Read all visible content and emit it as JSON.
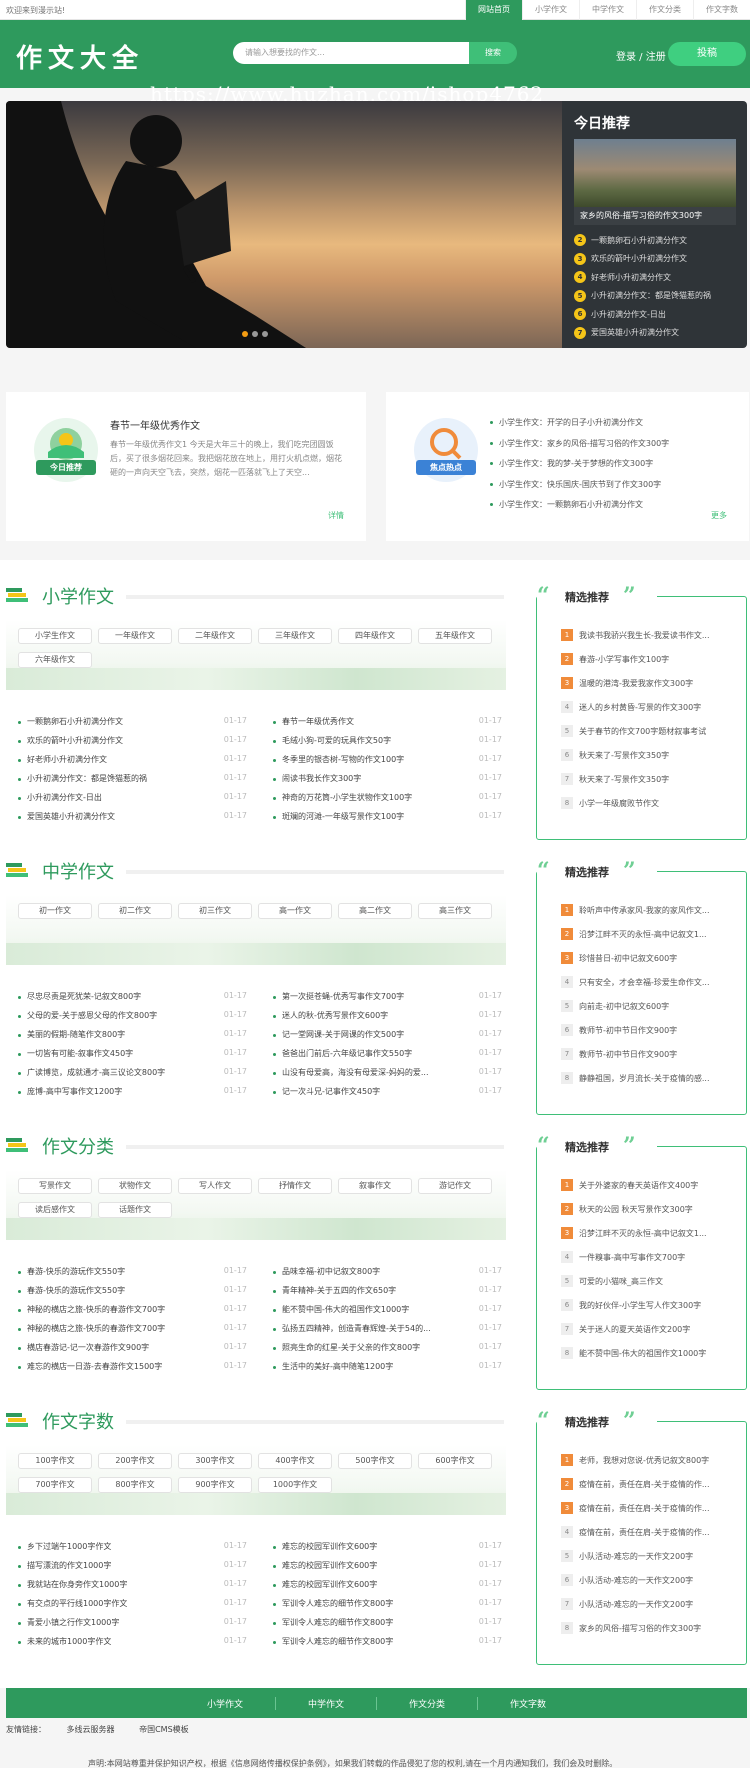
{
  "topbar": {
    "welcome": "欢迎来到漫示站!",
    "nav": [
      "网站首页",
      "小学作文",
      "中学作文",
      "作文分类",
      "作文字数"
    ]
  },
  "header": {
    "logo": "作文大全",
    "search_placeholder": "请输入想要找的作文...",
    "search_button": "搜索",
    "login": "登录 / 注册",
    "submit": "投稿",
    "watermark": "https://www.huzhan.com/ishop4762"
  },
  "colors": {
    "brand": "#2e9a5d",
    "accent": "#3fbf78",
    "hot": "#f08b3a",
    "rank": "#f5c518"
  },
  "today": {
    "title": "今日推荐",
    "caption": "家乡的风俗-描写习俗的作文300字",
    "items": [
      {
        "n": "2",
        "t": "一颗鹅卵石小升初满分作文"
      },
      {
        "n": "3",
        "t": "欢乐的箭叶小升初满分作文"
      },
      {
        "n": "4",
        "t": "好老师小升初满分作文"
      },
      {
        "n": "5",
        "t": "小升初满分作文：都是馋猫惹的祸"
      },
      {
        "n": "6",
        "t": "小升初满分作文-日出"
      },
      {
        "n": "7",
        "t": "爱国英雄小升初满分作文"
      }
    ]
  },
  "card1": {
    "badge": "今日推荐",
    "title": "春节一年级优秀作文",
    "summary": "春节一年级优秀作文1 今天是大年三十的晚上，我们吃完团圆饭后，买了很多烟花回来。我把烟花放在地上，用打火机点燃，烟花砸的一声向天空飞去，突然，烟花一匹落就飞上了天空...",
    "more": "详情"
  },
  "card2": {
    "badge": "焦点热点",
    "items": [
      "小学生作文：开学的日子小升初满分作文",
      "小学生作文：家乡的风俗-描写习俗的作文300字",
      "小学生作文：我的梦-关于梦想的作文300字",
      "小学生作文：快乐国庆-国庆节到了作文300字",
      "小学生作文：一颗鹅卵石小升初满分作文"
    ],
    "more": "更多"
  },
  "sections": [
    {
      "title": "小学作文",
      "grades": [
        "小学生作文",
        "一年级作文",
        "二年级作文",
        "三年级作文",
        "四年级作文",
        "五年级作文",
        "六年级作文"
      ],
      "left": [
        "一颗鹅卵石小升初满分作文",
        "欢乐的箭叶小升初满分作文",
        "好老师小升初满分作文",
        "小升初满分作文：都是馋猫惹的祸",
        "小升初满分作文-日出",
        "爱国英雄小升初满分作文"
      ],
      "right": [
        "春节一年级优秀作文",
        "毛绒小狗-可爱的玩具作文50字",
        "冬季里的银杏树-写物的作文100字",
        "闹读书我长作文300字",
        "神奇的万花筒-小学生状物作文100字",
        "斑斓的河滩-一年级写景作文100字"
      ],
      "date": "01-17",
      "pick_title": "精选推荐",
      "pick": [
        "我读书我骄兴我生长-我爱读书作文...",
        "春游-小学写事作文100字",
        "温暖的港湾-我爱我家作文300字",
        "迷人的乡村黄昏-写景的作文300字",
        "关于春节的作文700字题材叙事考试",
        "秋天来了-写景作文350字",
        "秋天来了-写景作文350字",
        "小学一年级腐败节作文"
      ]
    },
    {
      "title": "中学作文",
      "grades": [
        "初一作文",
        "初二作文",
        "初三作文",
        "高一作文",
        "高二作文",
        "高三作文"
      ],
      "left": [
        "尽忠尽责是死犹荣-记叙文800字",
        "父母的爱-关于感恩父母的作文800字",
        "美丽的假期-随笔作文800字",
        "一切皆有可能-叙事作文450字",
        "广读博览，成就通才-高三议论文800字",
        "庞博-高中写事作文1200字"
      ],
      "right": [
        "第一次挺苍蝇-优秀写事作文700字",
        "迷人的秋-优秀写景作文600字",
        "记一堂网课-关于网课的作文500字",
        "爸爸出门前后-六年级记事作文550字",
        "山没有母爱高，海没有母爱深-妈妈的爱...",
        "记一次斗兄-记事作文450字"
      ],
      "date": "01-17",
      "pick_title": "精选推荐",
      "pick": [
        "聆听声中传承家风-我家的家风作文...",
        "沿梦江畔不灭的永恒-高中记叙文1...",
        "珍惜昔日-初中记叙文600字",
        "只有安全，才会幸福-珍爱生命作文...",
        "向前走-初中记叙文600字",
        "教师节-初中节日作文900字",
        "教师节-初中节日作文900字",
        "静静祖国，岁月流长-关于疫情的感..."
      ]
    },
    {
      "title": "作文分类",
      "grades": [
        "写景作文",
        "状物作文",
        "写人作文",
        "抒情作文",
        "叙事作文",
        "游记作文",
        "读后感作文",
        "话题作文"
      ],
      "left": [
        "春游-快乐的游玩作文550字",
        "春游-快乐的游玩作文550字",
        "神秘的横店之旅-快乐的春游作文700字",
        "神秘的横店之旅-快乐的春游作文700字",
        "横店春游记-记一次春游作文900字",
        "难忘的横店一日游-去春游作文1500字"
      ],
      "right": [
        "品味幸福-初中记叙文800字",
        "青年精神-关于五四的作文650字",
        "能不赞中国-伟大的祖国作文1000字",
        "弘扬五四精神，创造青春辉煌-关于54的...",
        "照亮生命的红星-关于父亲的作文800字",
        "生活中的美好-高中随笔1200字"
      ],
      "date": "01-17",
      "pick_title": "精选推荐",
      "pick": [
        "关于外婆家的春天英语作文400字",
        "秋天的公园 秋天写景作文300字",
        "沿梦江畔不灭的永恒-高中记叙文1...",
        "一件糗事-高中写事作文700字",
        "可爱的小猫咪_高三作文",
        "我的好伙伴-小学生写人作文300字",
        "关于迷人的夏天英语作文200字",
        "能不赞中国-伟大的祖国作文1000字"
      ]
    },
    {
      "title": "作文字数",
      "grades": [
        "100字作文",
        "200字作文",
        "300字作文",
        "400字作文",
        "500字作文",
        "600字作文",
        "700字作文",
        "800字作文",
        "900字作文",
        "1000字作文"
      ],
      "left": [
        "乡下过端午1000字作文",
        "描写漂流的作文1000字",
        "我就站在你身旁作文1000字",
        "有交点的平行线1000字作文",
        "青爱小镇之行作文1000字",
        "未来的城市1000字作文"
      ],
      "right": [
        "难忘的校园军训作文600字",
        "难忘的校园军训作文600字",
        "难忘的校园军训作文600字",
        "军训令人难忘的细节作文800字",
        "军训令人难忘的细节作文800字",
        "军训令人难忘的细节作文800字"
      ],
      "date": "01-17",
      "pick_title": "精选推荐",
      "pick": [
        "老师，我想对您说-优秀记叙文800字",
        "疫情在前，责任在肩-关于疫情的作...",
        "疫情在前，责任在肩-关于疫情的作...",
        "疫情在前，责任在肩-关于疫情的作...",
        "小队活动-难忘的一天作文200字",
        "小队活动-难忘的一天作文200字",
        "小队活动-难忘的一天作文200字",
        "家乡的风俗-描写习俗的作文300字"
      ]
    }
  ],
  "footer": {
    "nav": [
      "小学作文",
      "中学作文",
      "作文分类",
      "作文字数"
    ],
    "friends_label": "友情链接：",
    "friends": [
      "多线云服务器",
      "帝国CMS模板"
    ],
    "disclaimer": "声明:本网站尊重并保护知识产权，根据《信息网络传播权保护条例》，如果我们转载的作品侵犯了您的权利,请在一个月内通知我们，我们会及时删除。"
  }
}
